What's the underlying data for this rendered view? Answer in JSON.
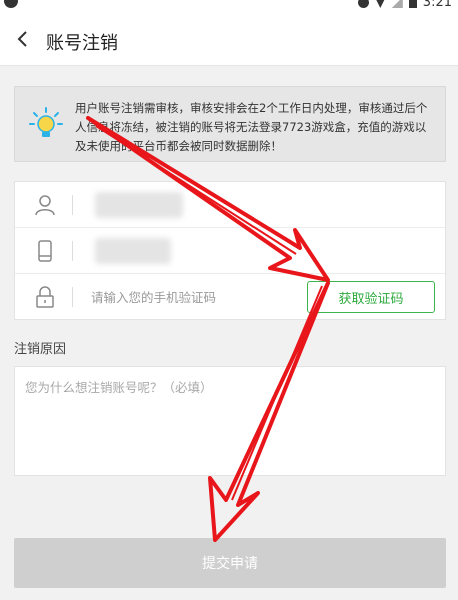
{
  "status_bar": {
    "time": "3:21"
  },
  "header": {
    "title": "账号注销",
    "back_icon": "chevron-left-icon"
  },
  "notice": {
    "icon": "lightbulb-icon",
    "text": "用户账号注销需审核，审核安排会在2个工作日内处理，审核通过后个人信息将冻结，被注销的账号将无法登录7723游戏盒，充值的游戏以及未使用的平台币都会被同时数据删除！"
  },
  "form": {
    "account_row": {
      "icon": "user-icon"
    },
    "phone_row": {
      "icon": "phone-icon"
    },
    "code_row": {
      "icon": "lock-icon",
      "placeholder": "请输入您的手机验证码",
      "button_label": "获取验证码"
    }
  },
  "reason": {
    "label": "注销原因",
    "placeholder": "您为什么想注销账号呢？（必填）"
  },
  "submit": {
    "label": "提交申请"
  },
  "colors": {
    "accent_green": "#2eaa3f",
    "annotation_red": "#e8161b",
    "submit_disabled": "#cfcfcf"
  }
}
